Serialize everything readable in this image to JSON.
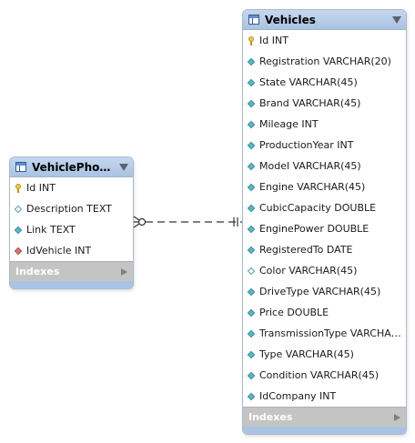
{
  "tables": {
    "vehicle_photos": {
      "title": "VehiclePhot...",
      "columns": [
        {
          "text": "Id INT",
          "icon": "key"
        },
        {
          "text": "Description TEXT",
          "icon": "diamond-empty"
        },
        {
          "text": "Link TEXT",
          "icon": "diamond"
        },
        {
          "text": "IdVehicle INT",
          "icon": "diamond-fk"
        }
      ],
      "indexes_label": "Indexes"
    },
    "vehicles": {
      "title": "Vehicles",
      "columns": [
        {
          "text": "Id INT",
          "icon": "key"
        },
        {
          "text": "Registration VARCHAR(20)",
          "icon": "diamond"
        },
        {
          "text": "State VARCHAR(45)",
          "icon": "diamond"
        },
        {
          "text": "Brand VARCHAR(45)",
          "icon": "diamond"
        },
        {
          "text": "Mileage INT",
          "icon": "diamond"
        },
        {
          "text": "ProductionYear INT",
          "icon": "diamond"
        },
        {
          "text": "Model VARCHAR(45)",
          "icon": "diamond"
        },
        {
          "text": "Engine VARCHAR(45)",
          "icon": "diamond"
        },
        {
          "text": "CubicCapacity DOUBLE",
          "icon": "diamond"
        },
        {
          "text": "EnginePower DOUBLE",
          "icon": "diamond"
        },
        {
          "text": "RegisteredTo DATE",
          "icon": "diamond"
        },
        {
          "text": "Color VARCHAR(45)",
          "icon": "diamond-empty"
        },
        {
          "text": "DriveType VARCHAR(45)",
          "icon": "diamond"
        },
        {
          "text": "Price DOUBLE",
          "icon": "diamond"
        },
        {
          "text": "TransmissionType VARCHAR(4...",
          "icon": "diamond"
        },
        {
          "text": "Type VARCHAR(45)",
          "icon": "diamond"
        },
        {
          "text": "Condition VARCHAR(45)",
          "icon": "diamond"
        },
        {
          "text": "IdCompany INT",
          "icon": "diamond"
        }
      ],
      "indexes_label": "Indexes"
    }
  },
  "relationship": {
    "from_cardinality": "zero-or-many",
    "to_cardinality": "exactly-one",
    "style": "dashed"
  },
  "colors": {
    "header_fill": "#a9c3e3",
    "table_border": "#a9bacf",
    "indexes_fill": "#c4c4c4",
    "connector": "#333333"
  }
}
